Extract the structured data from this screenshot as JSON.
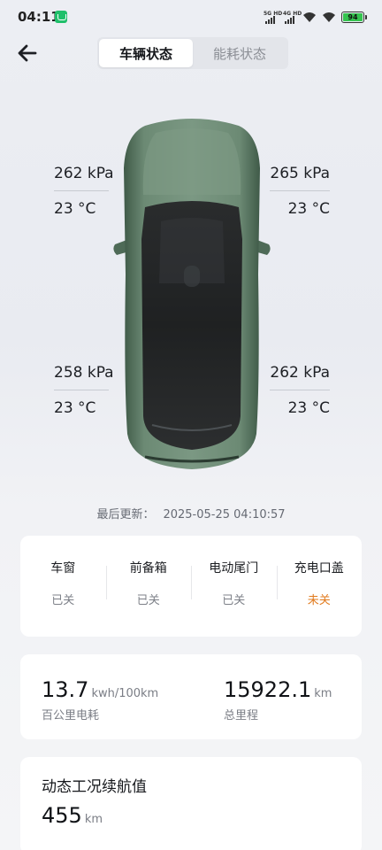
{
  "status_bar": {
    "time": "04:11",
    "network1": "5G HD",
    "network2": "4G HD",
    "battery": "94"
  },
  "header": {
    "tabs": [
      {
        "label": "车辆状态",
        "active": true
      },
      {
        "label": "能耗状态",
        "active": false
      }
    ]
  },
  "tires": {
    "front_left": {
      "pressure": "262 kPa",
      "temp": "23 °C"
    },
    "front_right": {
      "pressure": "265 kPa",
      "temp": "23 °C"
    },
    "rear_left": {
      "pressure": "258 kPa",
      "temp": "23 °C"
    },
    "rear_right": {
      "pressure": "262 kPa",
      "temp": "23 °C"
    }
  },
  "last_updated": {
    "label": "最后更新：",
    "value": "2025-05-25 04:10:57"
  },
  "closures": [
    {
      "label": "车窗",
      "state": "已关",
      "warning": false
    },
    {
      "label": "前备箱",
      "state": "已关",
      "warning": false
    },
    {
      "label": "电动尾门",
      "state": "已关",
      "warning": false
    },
    {
      "label": "充电口盖",
      "state": "未关",
      "warning": true
    }
  ],
  "stats": {
    "consumption": {
      "value": "13.7",
      "unit": "kwh/100km",
      "label": "百公里电耗"
    },
    "odometer": {
      "value": "15922.1",
      "unit": "km",
      "label": "总里程"
    }
  },
  "range": {
    "title": "动态工况续航值",
    "value": "455",
    "unit": "km"
  },
  "colors": {
    "car_body": "#5f7c68",
    "warning": "#e17a1c",
    "battery_fill": "#35c34f"
  }
}
